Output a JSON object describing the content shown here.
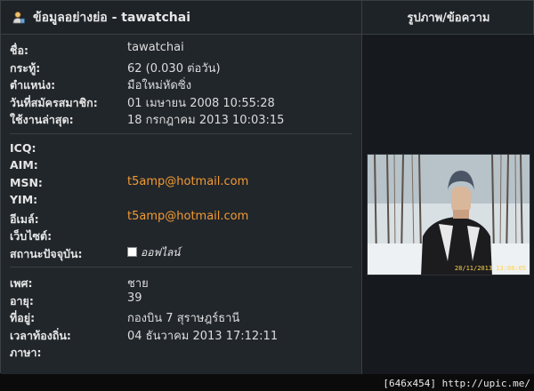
{
  "header": {
    "title": "ข้อมูลอย่างย่อ - tawatchai",
    "photo_column_title": "รูปภาพ/ข้อความ",
    "user_icon": "user-icon"
  },
  "profile": {
    "name_label": "ชื่อ:",
    "name_value": "tawatchai",
    "posts_label": "กระทู้:",
    "posts_value": "62 (0.030 ต่อวัน)",
    "rank_label": "ตำแหน่ง:",
    "rank_value": "มือใหม่หัดซิ่ง",
    "joined_label": "วันที่สมัครสมาชิก:",
    "joined_value": "01 เมษายน 2008 10:55:28",
    "last_active_label": "ใช้งานล่าสุด:",
    "last_active_value": "18 กรกฎาคม 2013 10:03:15"
  },
  "contact": {
    "icq_label": "ICQ:",
    "icq_value": "",
    "aim_label": "AIM:",
    "aim_value": "",
    "msn_label": "MSN:",
    "msn_value": "t5amp@hotmail.com",
    "yim_label": "YIM:",
    "yim_value": "",
    "email_label": "อีเมล์:",
    "email_value": "t5amp@hotmail.com",
    "website_label": "เว็บไซต์:",
    "website_value": "",
    "status_label": "สถานะปัจจุบัน:",
    "status_value": "ออฟไลน์"
  },
  "personal": {
    "gender_label": "เพศ:",
    "gender_value": "ชาย",
    "age_label": "อายุ:",
    "age_value": "39",
    "location_label": "ที่อยู่:",
    "location_value": "กองบิน 7 สุราษฎร์ธานี",
    "local_time_label": "เวลาท้องถิ่น:",
    "local_time_value": "04 ธันวาคม 2013 17:12:11",
    "language_label": "ภาษา:",
    "language_value": ""
  },
  "photo": {
    "date_stamp": "28/11/2013 13:08:05"
  },
  "footer": {
    "text": "[646x454] http://upic.me/"
  },
  "colors": {
    "accent": "#f29a32",
    "panel": "#21262b",
    "text": "#e6e6e6"
  }
}
